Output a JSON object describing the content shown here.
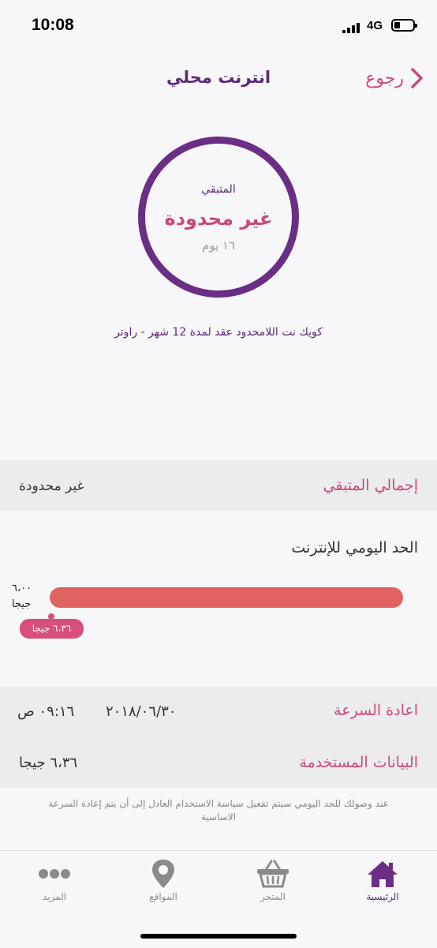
{
  "status_bar": {
    "time": "10:08",
    "network": "4G"
  },
  "header": {
    "back_label": "رجوع",
    "title": "انترنت محلي"
  },
  "ring": {
    "label": "المتبقي",
    "value": "غير محدودة",
    "days": "١٦ يوم"
  },
  "plan_name": "كويك نت اللامحدود عقد لمدة 12 شهر - راوتر",
  "total_remaining": {
    "label": "إجمالي المتبقي",
    "value": "غير محدودة"
  },
  "daily_limit": {
    "title": "الحد اليومي للإنترنت",
    "limit_value": "٦،٠٠",
    "limit_unit": "جيجا",
    "used_badge": "٦،٣٦ جيجا",
    "used_fraction": 1.0
  },
  "details": {
    "reset_label": "اعادة السرعة",
    "reset_date": "٢٠١٨/٠٦/٣٠",
    "reset_time": "٠٩:١٦ ص",
    "used_label": "البيانات المستخدمة",
    "used_value": "٦،٣٦ جيجا"
  },
  "note": "عند وصولك للحد اليومي سيتم تفعيل سياسة الاستخدام العادل إلى أن يتم إعادة السرعة الاساسية",
  "tabbar": {
    "home": "الرئيسية",
    "store": "المتجر",
    "locations": "المواقع",
    "more": "المزيد"
  },
  "colors": {
    "primary_purple": "#6a2e84",
    "accent_pink": "#c84b79",
    "bar_red": "#e16360"
  }
}
